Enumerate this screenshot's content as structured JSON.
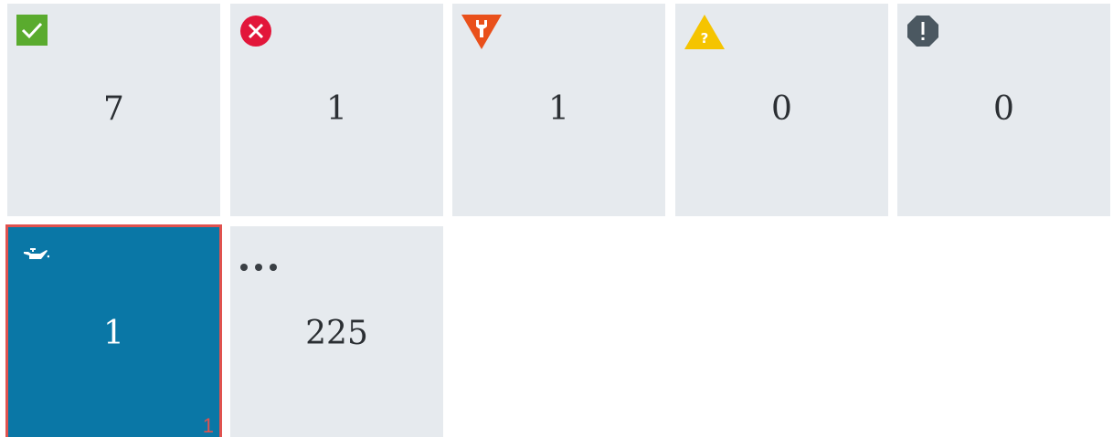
{
  "tiles": [
    {
      "count": "7",
      "icon": "check-icon",
      "color": "#5aab2e"
    },
    {
      "count": "1",
      "icon": "error-circle-icon",
      "color": "#e2163a"
    },
    {
      "count": "1",
      "icon": "wrench-triangle-icon",
      "color": "#e9501b"
    },
    {
      "count": "0",
      "icon": "warning-question-icon",
      "color": "#f5c400"
    },
    {
      "count": "0",
      "icon": "exclamation-octagon-icon",
      "color": "#4b5861"
    },
    {
      "count": "1",
      "icon": "oil-can-icon",
      "color": "#0a77a6",
      "badge": "1",
      "selected": true
    },
    {
      "count": "225",
      "icon": "more-dots-icon",
      "color": "#3a3f44"
    }
  ],
  "colors": {
    "tile_bg": "#e6eaee",
    "active_bg": "#0a77a6",
    "active_border": "#e0524f"
  }
}
